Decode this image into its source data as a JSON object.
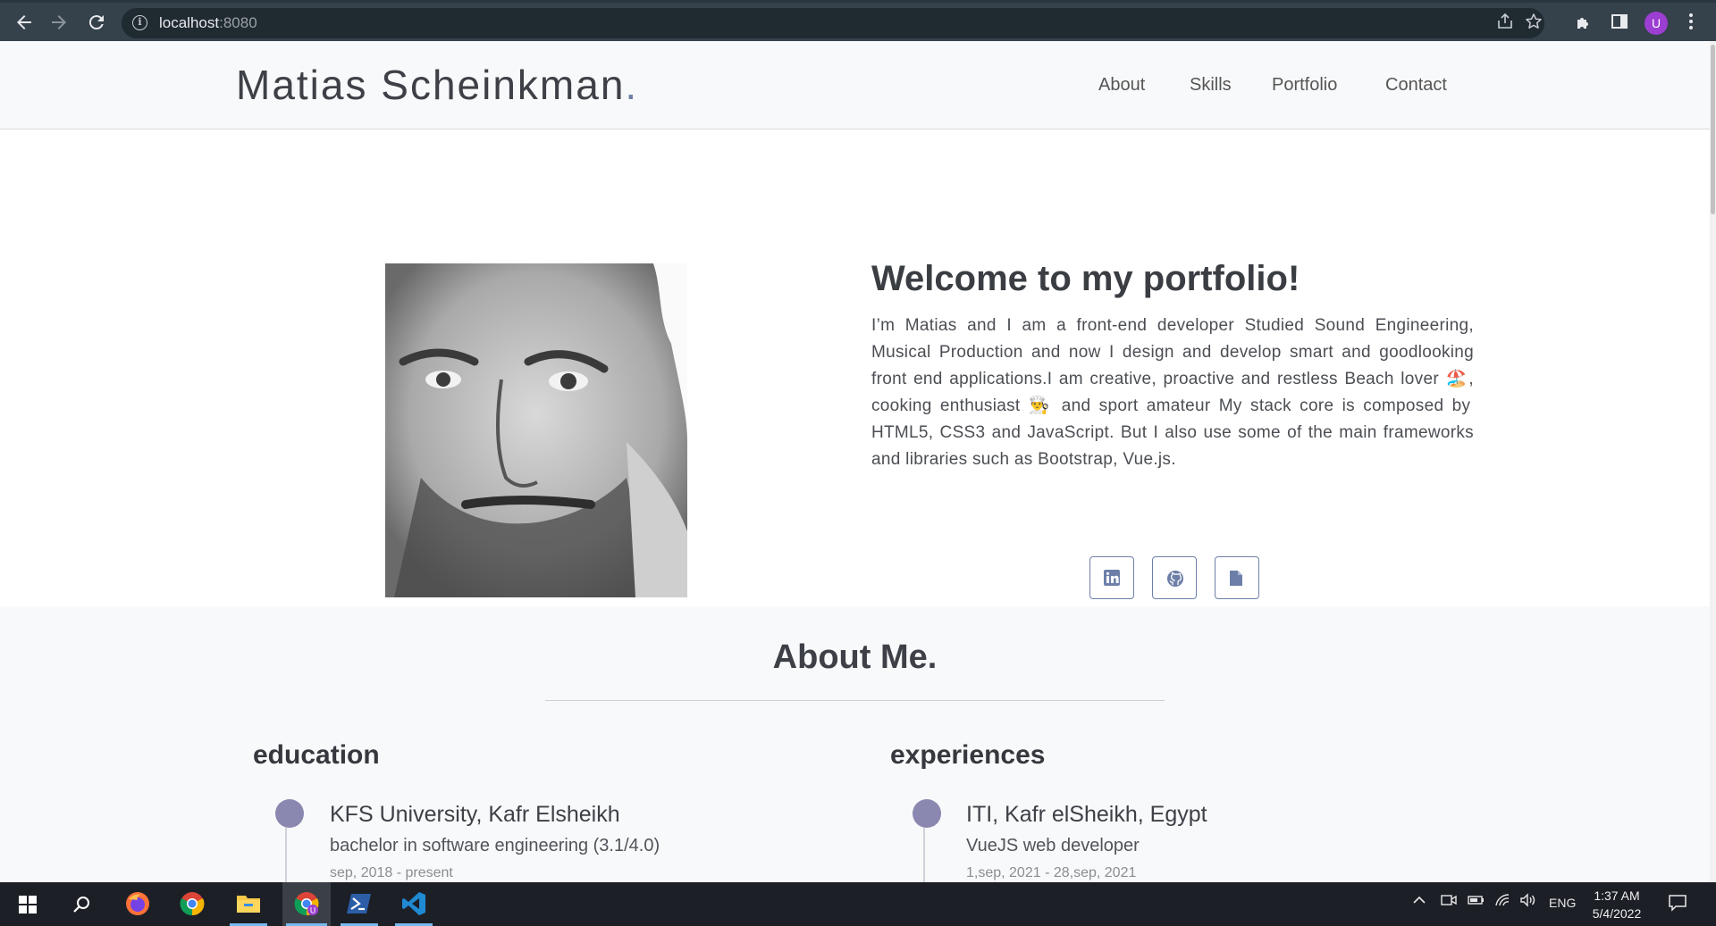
{
  "browser": {
    "url_host": "localhost",
    "url_port": ":8080",
    "profile_initial": "U"
  },
  "site": {
    "brand": "Matias Scheinkman",
    "brand_dot": ".",
    "nav": [
      "About",
      "Skills",
      "Portfolio",
      "Contact"
    ]
  },
  "hero": {
    "title": "Welcome to my portfolio!",
    "bio": "I’m Matias and I am a front-end developer Studied Sound Engineering, Musical Production and now I design and develop smart and goodlooking front end applications.I am creative, proactive and restless Beach lover 🏖️, cooking enthusiast 👨‍🍳 and sport amateur My stack core is composed by HTML5, CSS3 and JavaScript. But I also use some of the main frameworks and libraries such as Bootstrap, Vue.js.",
    "social_icons": [
      "linkedin-icon",
      "github-icon",
      "document-icon"
    ]
  },
  "about": {
    "title": "About Me.",
    "education": {
      "heading": "education",
      "items": [
        {
          "title": "KFS University, Kafr Elsheikh",
          "subtitle": "bachelor in software engineering (3.1/4.0)",
          "date": "sep, 2018 - present"
        }
      ]
    },
    "experiences": {
      "heading": "experiences",
      "items": [
        {
          "title": "ITI, Kafr elSheikh, Egypt",
          "subtitle": "VueJS web developer",
          "date": "1,sep, 2021 - 28,sep, 2021"
        }
      ]
    }
  },
  "taskbar": {
    "apps": [
      "firefox-icon",
      "chrome-icon",
      "file-explorer-icon",
      "chrome-profile-icon",
      "powershell-icon",
      "vscode-icon"
    ],
    "language": "ENG",
    "time": "1:37 AM",
    "date": "5/4/2022"
  },
  "colors": {
    "accent": "#6d7fa8",
    "timeline_dot": "#8a88b0",
    "chrome_bar": "#35414b",
    "taskbar": "#1c1f26"
  }
}
